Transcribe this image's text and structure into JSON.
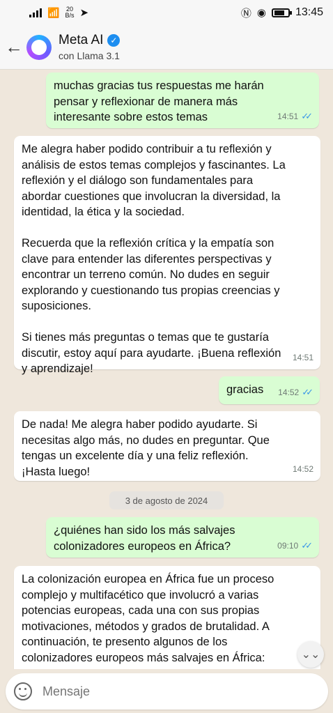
{
  "status_bar": {
    "speed_value": "20",
    "speed_unit": "B/s",
    "time": "13:45"
  },
  "header": {
    "back_icon": "arrow-left-icon",
    "name": "Meta AI",
    "subtitle": "con Llama 3.1"
  },
  "messages": [
    {
      "direction": "out",
      "text": "muchas gracias tus respuestas me harán\npensar y reflexionar de manera más\ninteresante sobre estos temas",
      "time": "14:51",
      "read": true
    },
    {
      "direction": "in",
      "text": "Me alegra haber podido contribuir a tu reflexión y\nanálisis de estos temas complejos y fascinantes. La\nreflexión y el diálogo son fundamentales para\nabordar cuestiones que involucran la diversidad, la\nidentidad, la ética y la sociedad.\n\nRecuerda que la reflexión crítica y la empatía son\nclave para entender las diferentes perspectivas y\nencontrar un terreno común. No dudes en seguir\nexplorando y cuestionando tus propias creencias y\nsuposiciones.\n\nSi tienes más preguntas o temas que te gustaría\ndiscutir, estoy aquí para ayudarte. ¡Buena reflexión\ny aprendizaje!",
      "time": "14:51"
    },
    {
      "direction": "out",
      "text": "gracias",
      "time": "14:52",
      "read": true
    },
    {
      "direction": "in",
      "text": "De nada! Me alegra haber podido ayudarte. Si\nnecesitas algo más, no dudes en preguntar. Que\ntengas un excelente día y una feliz reflexión.\n¡Hasta luego!",
      "time": "14:52"
    },
    {
      "direction": "out",
      "text": "¿quiénes han sido los más salvajes\ncolonizadores europeos en África?",
      "time": "09:10",
      "read": true
    },
    {
      "direction": "in",
      "text": "La colonización europea en África fue un proceso\ncomplejo y multifacético que involucró a varias\npotencias europeas, cada una con sus propias\nmotivaciones, métodos y grados de brutalidad. A\ncontinuación, te presento algunos de los\ncolonizadores europeos más salvajes en África:",
      "time": ""
    }
  ],
  "date_separator": "3 de agosto de 2024",
  "input": {
    "placeholder": "Mensaje"
  },
  "colors": {
    "outgoing_bubble": "#d9fdd3",
    "incoming_bubble": "#ffffff",
    "read_ticks": "#3a97e8",
    "chat_background": "#efe7dc"
  }
}
